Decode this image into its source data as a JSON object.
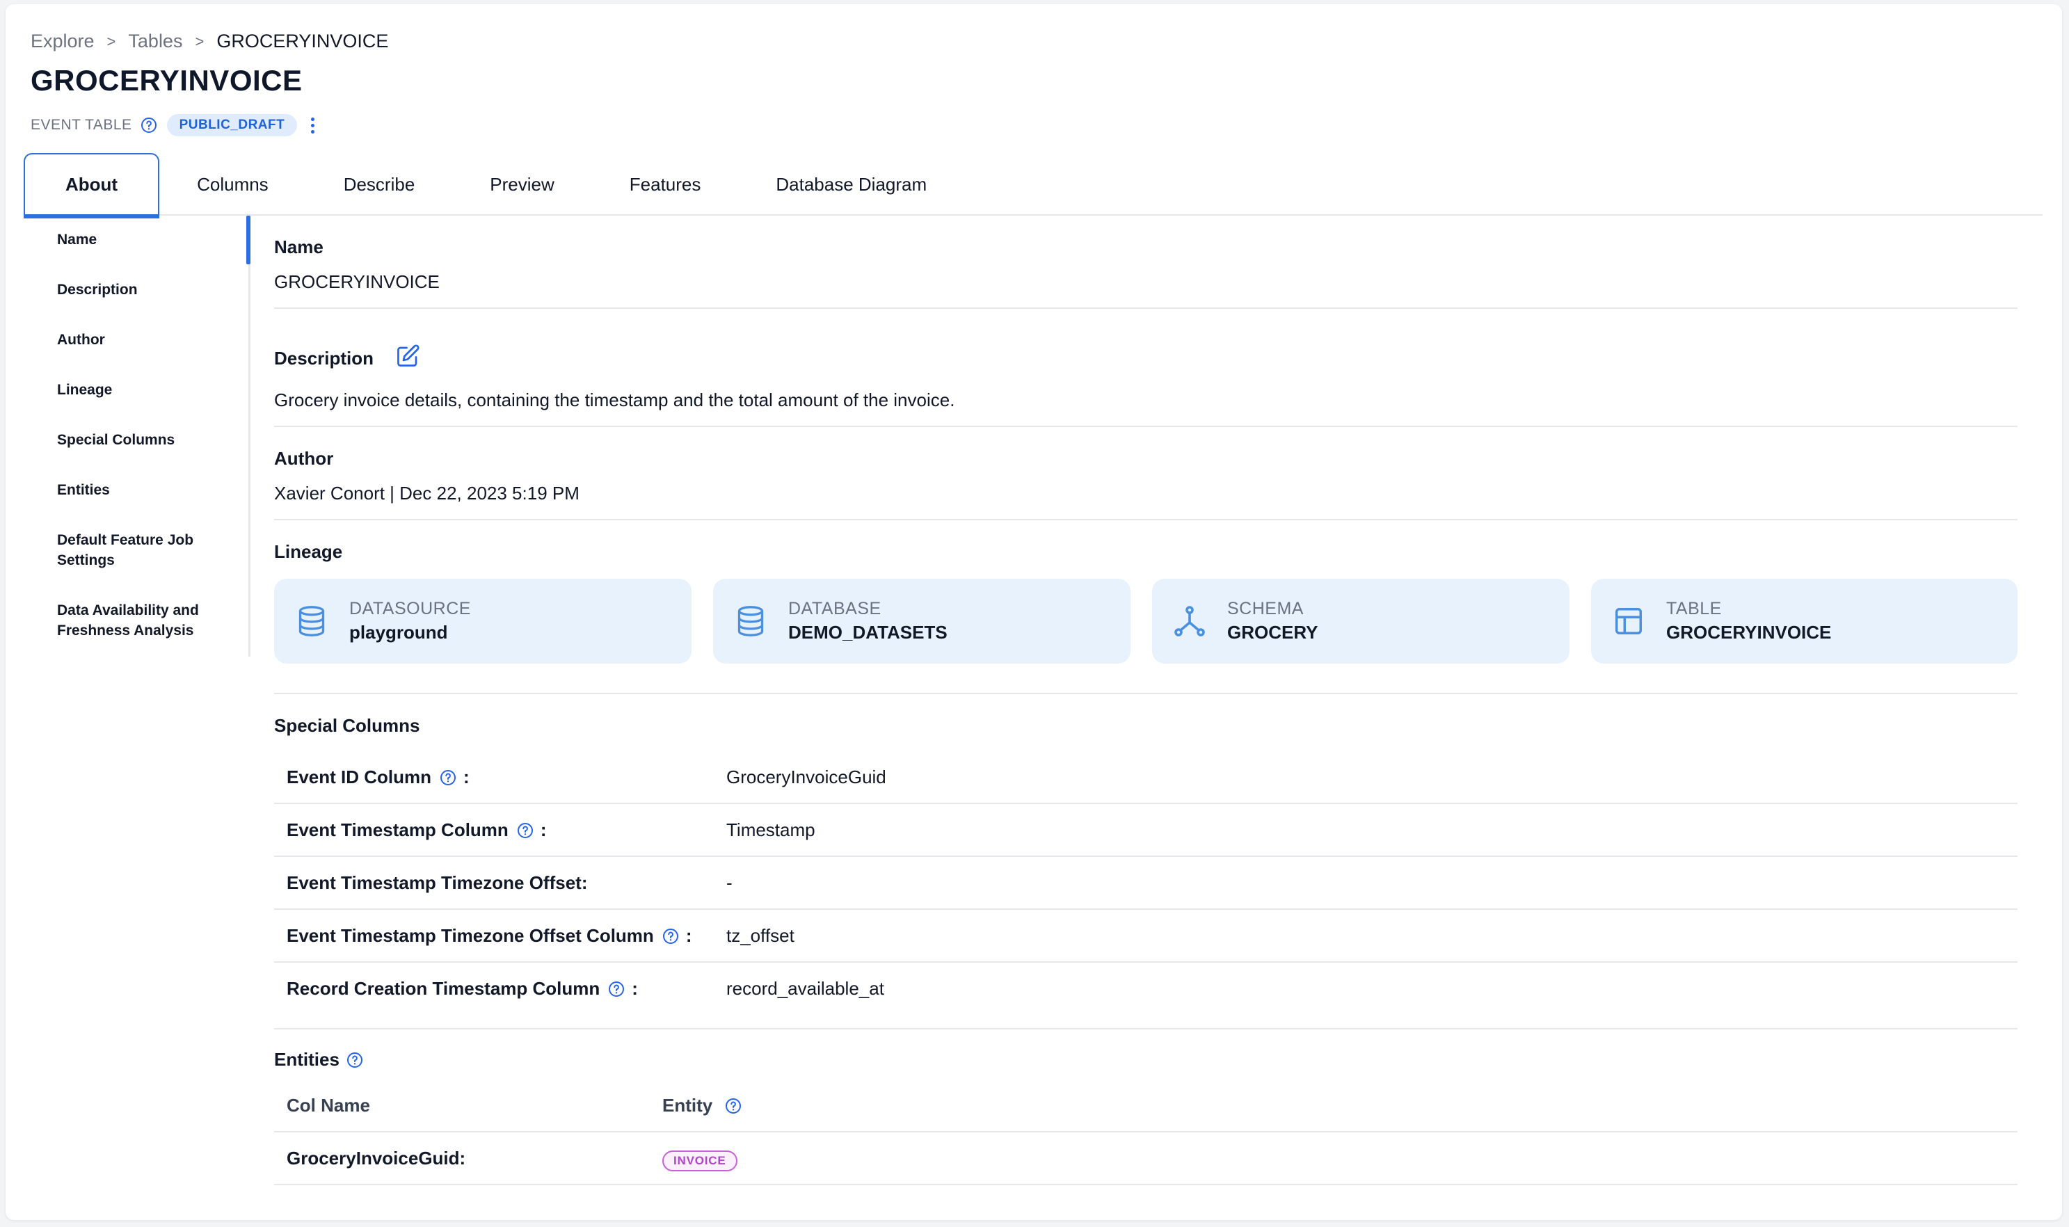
{
  "breadcrumb": {
    "items": [
      "Explore",
      "Tables",
      "GROCERYINVOICE"
    ],
    "separator": ">"
  },
  "page": {
    "title": "GROCERYINVOICE",
    "type_label": "EVENT TABLE",
    "status_badge": "PUBLIC_DRAFT"
  },
  "tabs": [
    {
      "label": "About",
      "active": true
    },
    {
      "label": "Columns"
    },
    {
      "label": "Describe"
    },
    {
      "label": "Preview"
    },
    {
      "label": "Features"
    },
    {
      "label": "Database Diagram"
    }
  ],
  "side_nav": {
    "items": [
      {
        "label": "Name"
      },
      {
        "label": "Description"
      },
      {
        "label": "Author"
      },
      {
        "label": "Lineage"
      },
      {
        "label": "Special Columns"
      },
      {
        "label": "Entities"
      },
      {
        "label": "Default Feature Job Settings"
      },
      {
        "label": "Data Availability and Freshness Analysis"
      }
    ]
  },
  "about": {
    "name_label": "Name",
    "name_value": "GROCERYINVOICE",
    "description_label": "Description",
    "description_value": "Grocery invoice details, containing the timestamp and the total amount of the invoice.",
    "author_label": "Author",
    "author_value": "Xavier Conort | Dec 22, 2023 5:19 PM",
    "lineage_label": "Lineage",
    "lineage": [
      {
        "type": "DATASOURCE",
        "value": "playground",
        "icon": "database-icon"
      },
      {
        "type": "DATABASE",
        "value": "DEMO_DATASETS",
        "icon": "database-icon"
      },
      {
        "type": "SCHEMA",
        "value": "GROCERY",
        "icon": "schema-icon"
      },
      {
        "type": "TABLE",
        "value": "GROCERYINVOICE",
        "icon": "table-icon"
      }
    ],
    "special_columns_label": "Special Columns",
    "special_columns": [
      {
        "key": "Event ID Column",
        "has_help": true,
        "value": "GroceryInvoiceGuid"
      },
      {
        "key": "Event Timestamp Column",
        "has_help": true,
        "value": "Timestamp"
      },
      {
        "key": "Event Timestamp Timezone Offset:",
        "has_help": false,
        "value": "-"
      },
      {
        "key": "Event Timestamp Timezone Offset Column",
        "has_help": true,
        "value": "tz_offset"
      },
      {
        "key": "Record Creation Timestamp Column",
        "has_help": true,
        "value": "record_available_at"
      }
    ],
    "entities_label": "Entities",
    "entities_header": {
      "col_name": "Col Name",
      "entity": "Entity"
    },
    "entities": [
      {
        "col_name": "GroceryInvoiceGuid:",
        "entity": "INVOICE"
      }
    ]
  },
  "colors": {
    "accent": "#2b6fe0",
    "lineage_bg": "#e8f2fc",
    "badge_bg": "#e0ecfd",
    "entity_badge": "#b045c8"
  }
}
